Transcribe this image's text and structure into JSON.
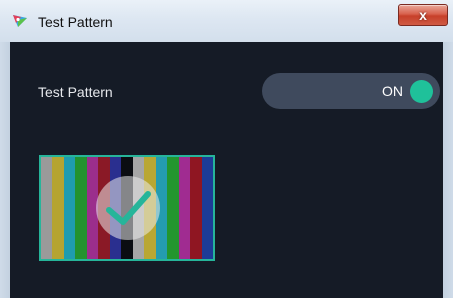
{
  "window": {
    "title": "Test Pattern",
    "close_glyph": "x",
    "app_icon": "colored-triangle-icon"
  },
  "setting": {
    "label": "Test Pattern",
    "toggle_text": "ON",
    "toggle_on": true
  },
  "pattern": {
    "selected": true,
    "check_icon": "checkmark-icon",
    "bar_colors": [
      "#9a9a9a",
      "#b5a431",
      "#1f9caf",
      "#23922f",
      "#9b2e8c",
      "#8a1926",
      "#2a2f8f",
      "#0b0d12",
      "#a6a6a6",
      "#b9a733",
      "#249cb0",
      "#23962e",
      "#a02c91",
      "#8f1622",
      "#1d3c97"
    ]
  },
  "colors": {
    "content_bg": "#151b26",
    "toggle_bg": "#3f4a5d",
    "accent": "#1fc19a",
    "thumb_border": "#26b59a"
  }
}
